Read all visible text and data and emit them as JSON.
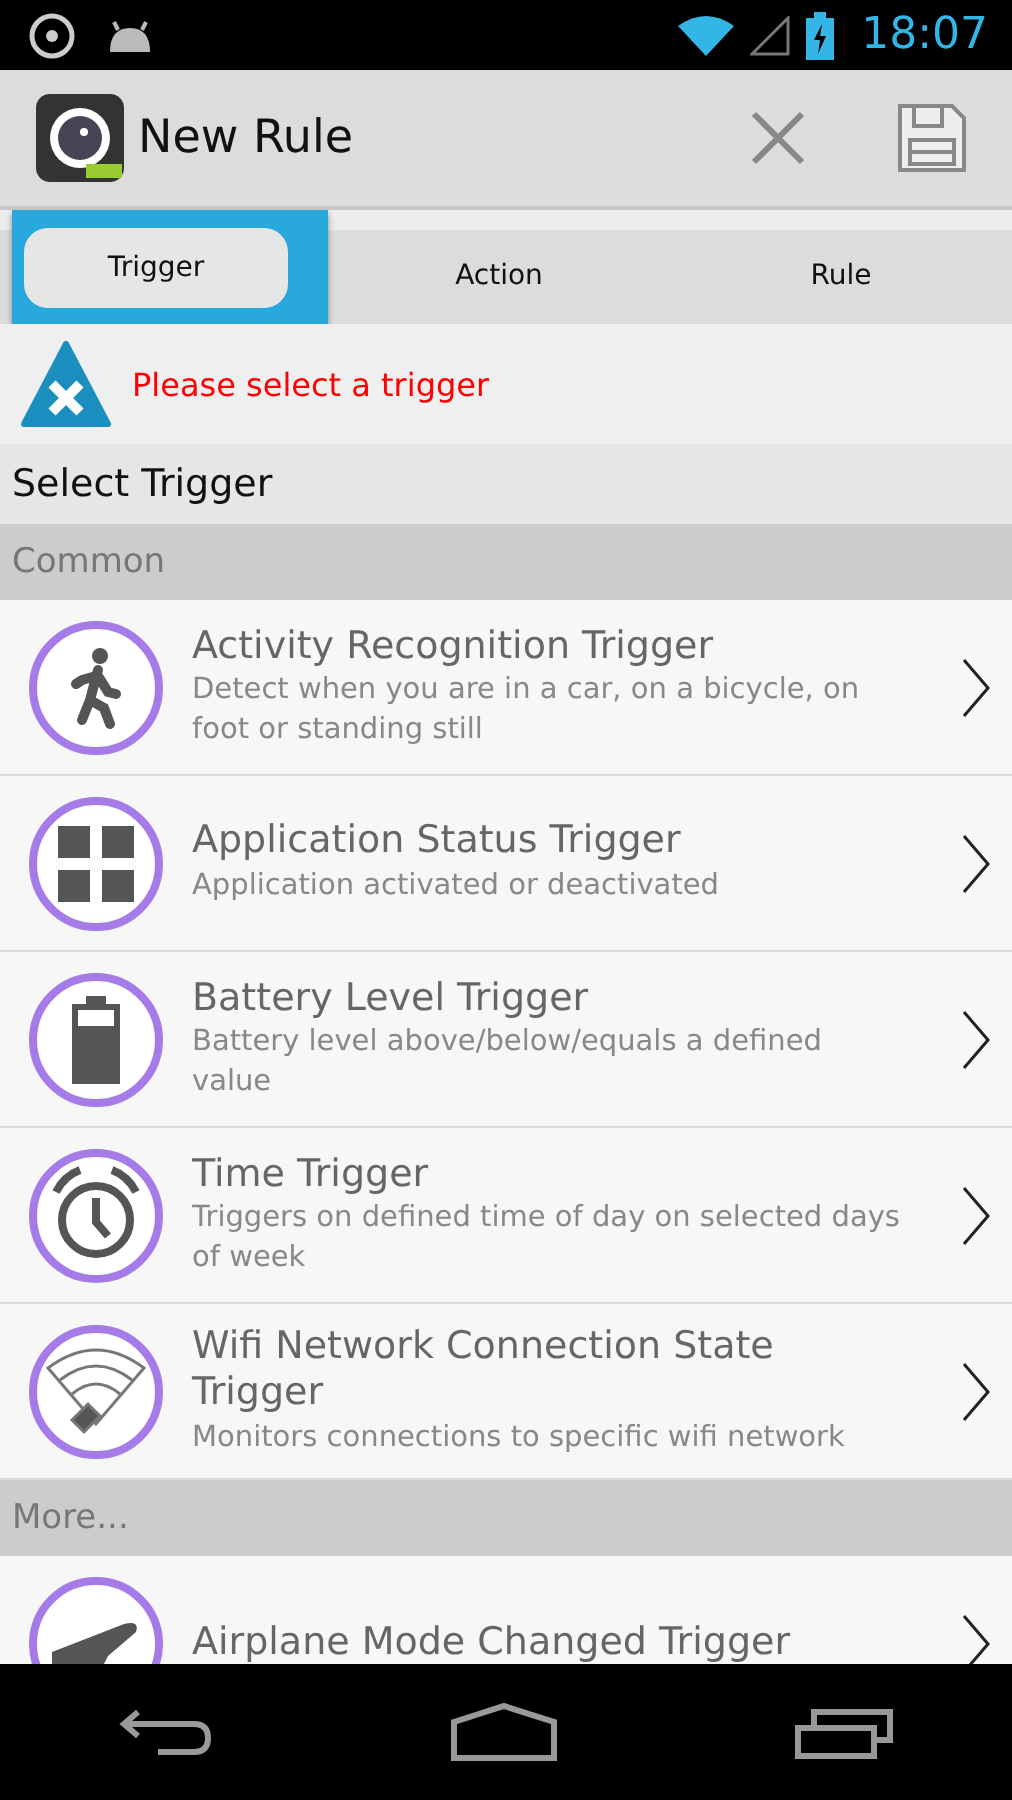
{
  "status_bar": {
    "time": "18:07"
  },
  "action_bar": {
    "title": "New Rule"
  },
  "tabs": [
    {
      "label": "Trigger",
      "selected": true
    },
    {
      "label": "Action",
      "selected": false
    },
    {
      "label": "Rule",
      "selected": false
    }
  ],
  "message": "Please select a trigger",
  "heading": "Select Trigger",
  "sections": [
    {
      "title": "Common",
      "items": [
        {
          "kind": "walk",
          "title": "Activity Recognition Trigger",
          "description": "Detect when you are in a car, on a bicycle, on foot or standing still"
        },
        {
          "kind": "grid",
          "title": "Application Status Trigger",
          "description": "Application activated or deactivated"
        },
        {
          "kind": "battery",
          "title": "Battery Level Trigger",
          "description": "Battery level above/below/equals a defined value"
        },
        {
          "kind": "alarm",
          "title": "Time Trigger",
          "description": "Triggers on defined time of day on selected days of week"
        },
        {
          "kind": "wifi",
          "title": "Wifi Network Connection State Trigger",
          "description": "Monitors connections to specific wifi network"
        }
      ]
    },
    {
      "title": "More...",
      "items": [
        {
          "kind": "plane",
          "title": "Airplane Mode Changed Trigger"
        }
      ]
    }
  ]
}
